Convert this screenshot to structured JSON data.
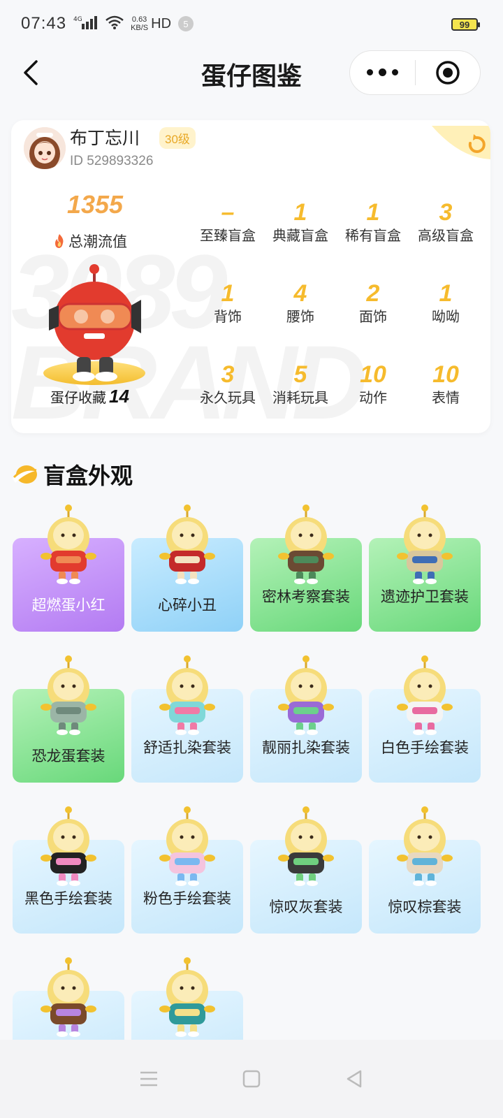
{
  "status_bar": {
    "time": "07:43",
    "network": "4G",
    "speed_value": "0.63",
    "speed_unit": "KB/S",
    "hd": "HD",
    "notification_count": "5",
    "battery": "99"
  },
  "nav": {
    "title": "蛋仔图鉴"
  },
  "profile": {
    "username": "布丁忘川",
    "level": "30级",
    "id_text": "ID 529893326",
    "total_value": "1355",
    "total_label": "总潮流值",
    "collection_label": "蛋仔收藏",
    "collection_count": "14",
    "watermark": "3089 BRAND"
  },
  "stats": [
    {
      "value": "–",
      "label": "至臻盲盒"
    },
    {
      "value": "1",
      "label": "典藏盲盒"
    },
    {
      "value": "1",
      "label": "稀有盲盒"
    },
    {
      "value": "3",
      "label": "高级盲盒"
    },
    {
      "value": "1",
      "label": "背饰"
    },
    {
      "value": "4",
      "label": "腰饰"
    },
    {
      "value": "2",
      "label": "面饰"
    },
    {
      "value": "1",
      "label": "呦呦"
    },
    {
      "value": "3",
      "label": "永久玩具"
    },
    {
      "value": "5",
      "label": "消耗玩具"
    },
    {
      "value": "10",
      "label": "动作"
    },
    {
      "value": "10",
      "label": "表情"
    }
  ],
  "section": {
    "title": "盲盒外观"
  },
  "items": [
    {
      "label": "超燃蛋小红",
      "bg": "purple",
      "body": "#e23b2e",
      "accent": "#f08a54"
    },
    {
      "label": "心碎小丑",
      "bg": "blue",
      "body": "#c42a2a",
      "accent": "#f4e2c0"
    },
    {
      "label": "密林考察套装",
      "bg": "green",
      "body": "#6b4a33",
      "accent": "#4d8a5a"
    },
    {
      "label": "遗迹护卫套装",
      "bg": "green",
      "body": "#d9c79c",
      "accent": "#3f6db5"
    },
    {
      "label": "恐龙蛋套装",
      "bg": "green",
      "body": "#9bb5a6",
      "accent": "#6f8a7c"
    },
    {
      "label": "舒适扎染套装",
      "bg": "lightblue",
      "body": "#7fd8d8",
      "accent": "#f07aa6"
    },
    {
      "label": "靓丽扎染套装",
      "bg": "lightblue",
      "body": "#9a6ad6",
      "accent": "#6cd08c"
    },
    {
      "label": "白色手绘套装",
      "bg": "lightblue",
      "body": "#f4f4f4",
      "accent": "#e86aa0"
    },
    {
      "label": "黑色手绘套装",
      "bg": "lightblue",
      "body": "#222222",
      "accent": "#f08ac0"
    },
    {
      "label": "粉色手绘套装",
      "bg": "lightblue",
      "body": "#f4c4de",
      "accent": "#7ab8f0"
    },
    {
      "label": "惊叹灰套装",
      "bg": "lightblue",
      "body": "#3a3a3a",
      "accent": "#6fcf7f"
    },
    {
      "label": "惊叹棕套装",
      "bg": "lightblue",
      "body": "#e8d8c0",
      "accent": "#5fb3d9"
    },
    {
      "label": "",
      "bg": "lightblue",
      "body": "#7a4a2a",
      "accent": "#b785e0"
    },
    {
      "label": "",
      "bg": "lightblue",
      "body": "#2f9a9a",
      "accent": "#f4e08a"
    }
  ]
}
